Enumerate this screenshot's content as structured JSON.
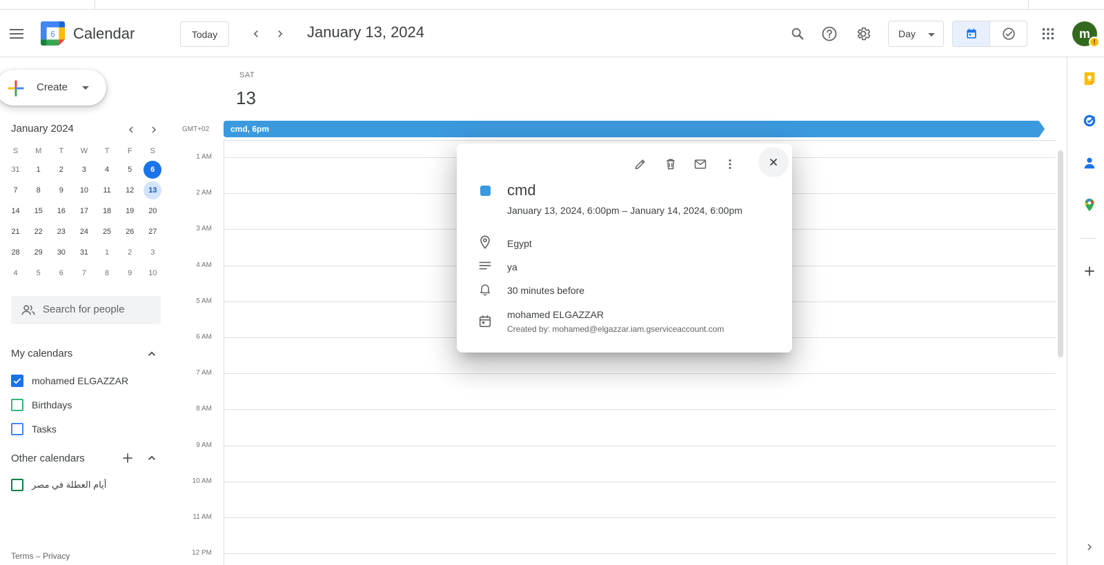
{
  "app": {
    "title": "Calendar",
    "logo_day": "6"
  },
  "header": {
    "today_label": "Today",
    "date_title": "January 13, 2024",
    "view_label": "Day",
    "avatar_letter": "m",
    "avatar_badge": "!"
  },
  "create": {
    "label": "Create"
  },
  "mini_calendar": {
    "month_label": "January 2024",
    "weekdays": [
      "S",
      "M",
      "T",
      "W",
      "T",
      "F",
      "S"
    ],
    "weeks": [
      [
        "31",
        "1",
        "2",
        "3",
        "4",
        "5",
        "6"
      ],
      [
        "7",
        "8",
        "9",
        "10",
        "11",
        "12",
        "13"
      ],
      [
        "14",
        "15",
        "16",
        "17",
        "18",
        "19",
        "20"
      ],
      [
        "21",
        "22",
        "23",
        "24",
        "25",
        "26",
        "27"
      ],
      [
        "28",
        "29",
        "30",
        "31",
        "1",
        "2",
        "3"
      ],
      [
        "4",
        "5",
        "6",
        "7",
        "8",
        "9",
        "10"
      ]
    ]
  },
  "people_search": {
    "placeholder": "Search for people"
  },
  "my_calendars": {
    "title": "My calendars",
    "items": [
      {
        "name": "mohamed ELGAZZAR",
        "color": "#1a73e8",
        "checked": true
      },
      {
        "name": "Birthdays",
        "color": "#33b679",
        "checked": false
      },
      {
        "name": "Tasks",
        "color": "#4285f4",
        "checked": false
      }
    ]
  },
  "other_calendars": {
    "title": "Other calendars",
    "items": [
      {
        "name": "أيام العطلة في مصر",
        "color": "#0b8043",
        "checked": false
      }
    ]
  },
  "footer": {
    "terms": "Terms",
    "sep": " – ",
    "privacy": "Privacy"
  },
  "day_view": {
    "dow": "SAT",
    "day_num": "13",
    "timezone": "GMT+02",
    "allday_event": "cmd, 6pm",
    "event_color": "#3b99dd",
    "hours": [
      "1 AM",
      "2 AM",
      "3 AM",
      "4 AM",
      "5 AM",
      "6 AM",
      "7 AM",
      "8 AM",
      "9 AM",
      "10 AM",
      "11 AM",
      "12 PM"
    ]
  },
  "popup": {
    "title": "cmd",
    "when": "January 13, 2024, 6:00pm – January 14, 2024, 6:00pm",
    "location": "Egypt",
    "description": "ya",
    "reminder": "30 minutes before",
    "calendar": "mohamed ELGAZZAR",
    "created_by": "Created by: mohamed@elgazzar.iam.gserviceaccount.com"
  },
  "colors": {
    "primary": "#1a73e8",
    "selected_day_bg": "#d2e3fc",
    "avatar_bg": "#33691e"
  }
}
